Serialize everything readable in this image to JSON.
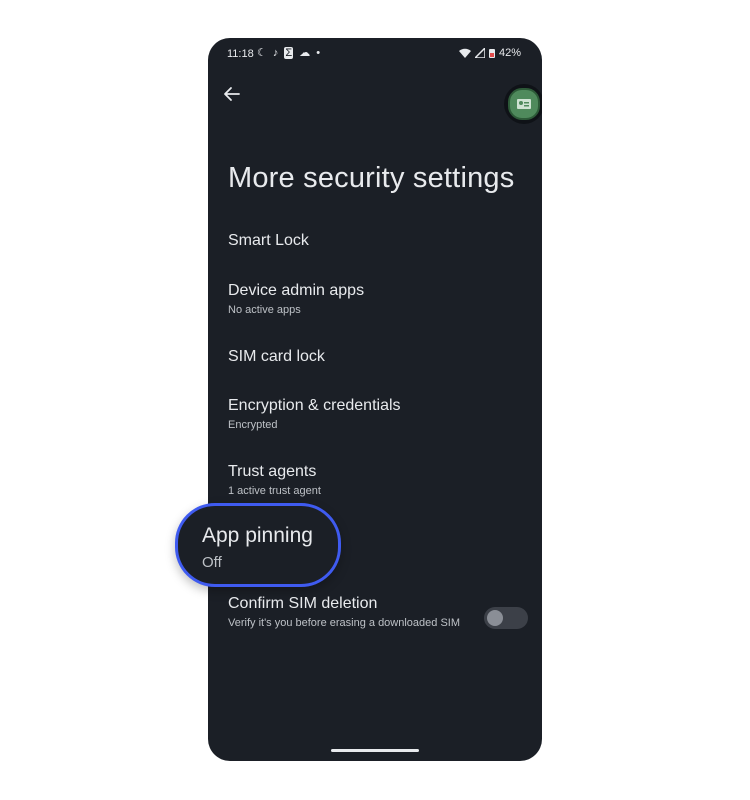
{
  "status_bar": {
    "time": "11:18",
    "left_icons": [
      "moon-icon",
      "tiktok-icon",
      "sigma-icon",
      "cloud-icon",
      "dot-icon"
    ],
    "battery_percent": "42%"
  },
  "header": {
    "back_icon": "arrow-left-icon"
  },
  "page_title": "More security settings",
  "items": [
    {
      "title": "Smart Lock",
      "subtitle": ""
    },
    {
      "title": "Device admin apps",
      "subtitle": "No active apps"
    },
    {
      "title": "SIM card lock",
      "subtitle": ""
    },
    {
      "title": "Encryption & credentials",
      "subtitle": "Encrypted"
    },
    {
      "title": "Trust agents",
      "subtitle": "1 active trust agent"
    },
    {
      "title": "App pinning",
      "subtitle": "Off"
    },
    {
      "title": "Confirm SIM deletion",
      "subtitle": "Verify it's you before erasing a downloaded SIM"
    }
  ],
  "toggle": {
    "state": "off"
  },
  "colors": {
    "background": "#1b1f26",
    "highlight_border": "#3f5bf0",
    "text_primary": "#e8eaed",
    "text_secondary": "#bdc1c6"
  }
}
